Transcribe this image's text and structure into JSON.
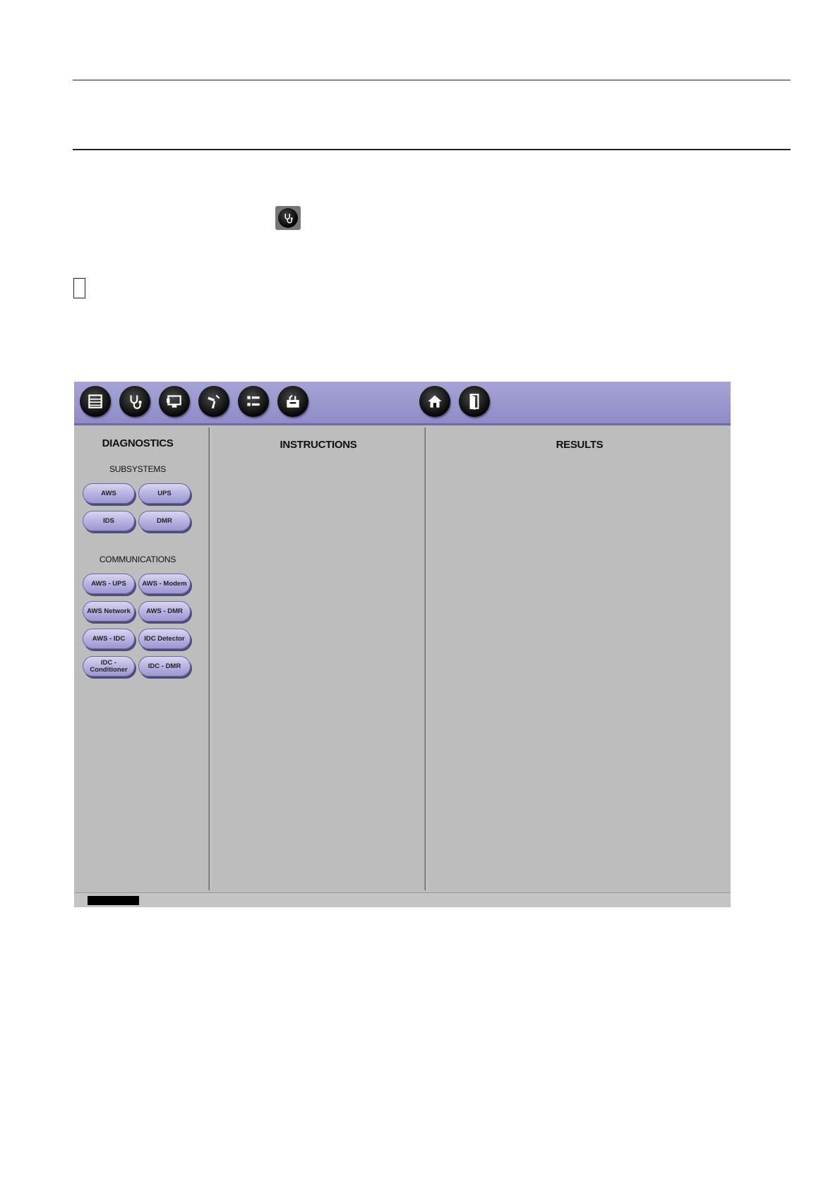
{
  "app": {
    "toolbar": {
      "icons": [
        "list-icon",
        "stethoscope-icon",
        "monitor-icon",
        "tools-icon",
        "checklist-icon",
        "toolbox-icon",
        "home-icon",
        "exit-door-icon"
      ]
    },
    "left_panel": {
      "title": "DIAGNOSTICS",
      "subsystems_title": "SUBSYSTEMS",
      "subsystems": [
        "AWS",
        "UPS",
        "IDS",
        "DMR"
      ],
      "communications_title": "COMMUNICATIONS",
      "communications": [
        "AWS - UPS",
        "AWS - Modem",
        "AWS Network",
        "AWS - DMR",
        "AWS - IDC",
        "IDC Detector",
        "IDC - Conditioner",
        "IDC - DMR"
      ]
    },
    "instructions_title": "INSTRUCTIONS",
    "results_title": "RESULTS"
  },
  "colors": {
    "toolbar": "#9a97d0",
    "panel_bg": "#bdbdbd",
    "button": "#b4b0e0"
  }
}
